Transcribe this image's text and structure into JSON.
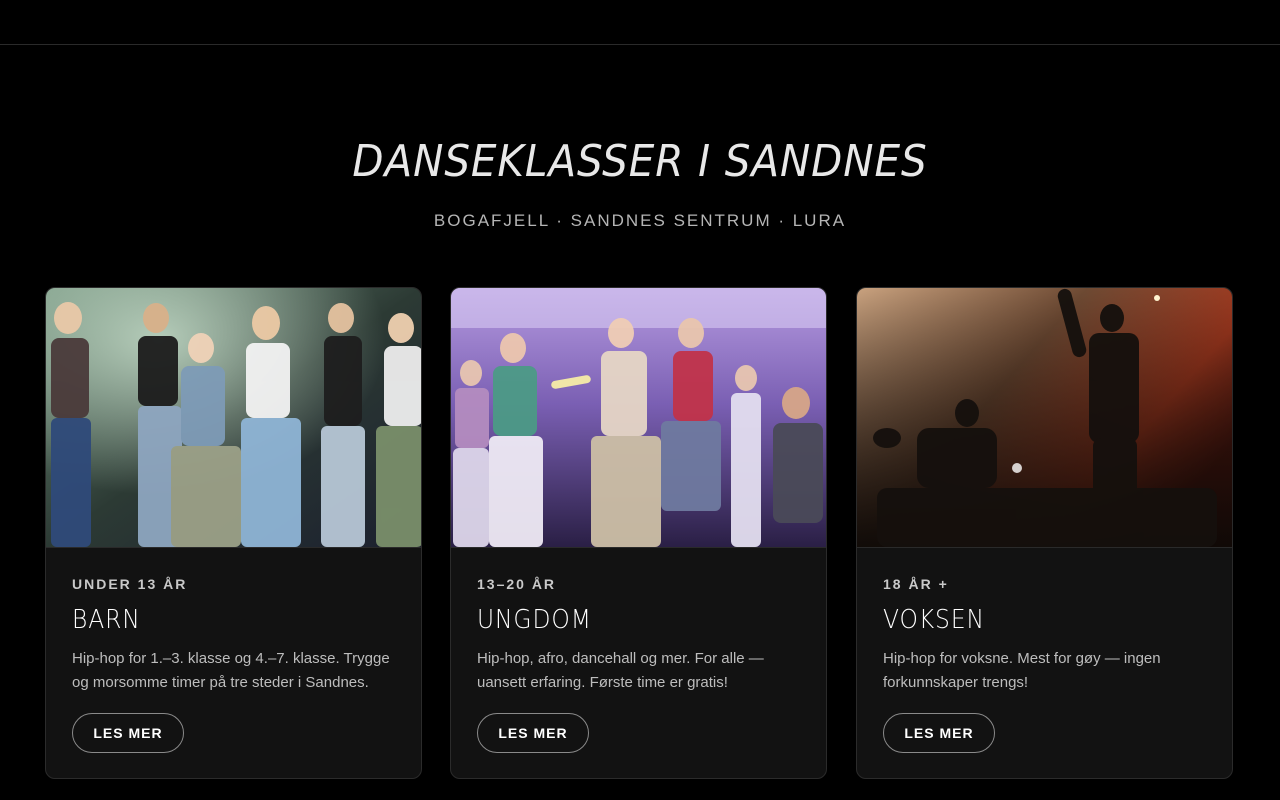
{
  "header": {
    "title": "DANSEKLASSER I SANDNES",
    "subtitle": "BOGAFJELL · SANDNES SENTRUM · LURA"
  },
  "cards": [
    {
      "age": "UNDER 13 ÅR",
      "title": "BARN",
      "description": "Hip-hop for 1.–3. klasse og 4.–7. klasse. Trygge og morsomme timer på tre steder i Sandnes.",
      "button_label": "LES MER",
      "image": "kids-dancing-on-stage-photo"
    },
    {
      "age": "13–20 ÅR",
      "title": "UNGDOM",
      "description": "Hip-hop, afro, dancehall og mer. For alle — uansett erfaring. Første time er gratis!",
      "button_label": "LES MER",
      "image": "youth-dancing-on-stage-photo"
    },
    {
      "age": "18 ÅR +",
      "title": "VOKSEN",
      "description": "Hip-hop for voksne. Mest for gøy — ingen forkunnskaper trengs!",
      "button_label": "LES MER",
      "image": "adults-dancing-on-stage-photo"
    }
  ],
  "colors": {
    "background": "#000000",
    "card": "#121212",
    "text": "#ffffff",
    "muted": "#bdbdbd"
  }
}
